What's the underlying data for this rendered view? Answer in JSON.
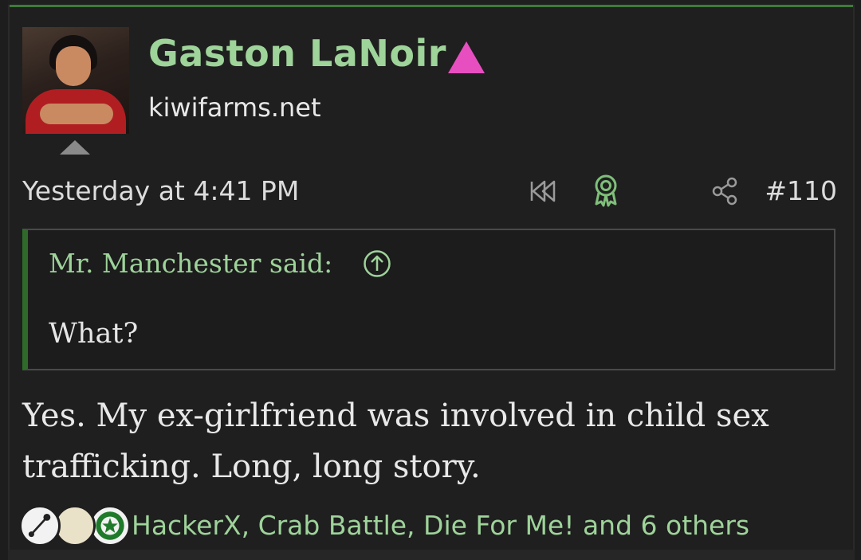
{
  "post": {
    "username": "Gaston LaNoir",
    "user_title": "kiwifarms.net",
    "timestamp": "Yesterday at 4:41 PM",
    "post_number": "#110",
    "icons": [
      "rewind-icon",
      "award-icon",
      "share-icon"
    ],
    "accent_color": "#9ed39a",
    "badge_color": "#e74fc0"
  },
  "quote": {
    "author": "Mr. Manchester said:",
    "text": "What?"
  },
  "body": {
    "text": "Yes. My ex-girlfriend was involved in child sex trafficking. Long, long story."
  },
  "reactions": {
    "icons": [
      "sound-icon",
      "moon-icon",
      "star-icon"
    ],
    "summary": "HackerX, Crab Battle, Die For Me! and 6 others"
  }
}
